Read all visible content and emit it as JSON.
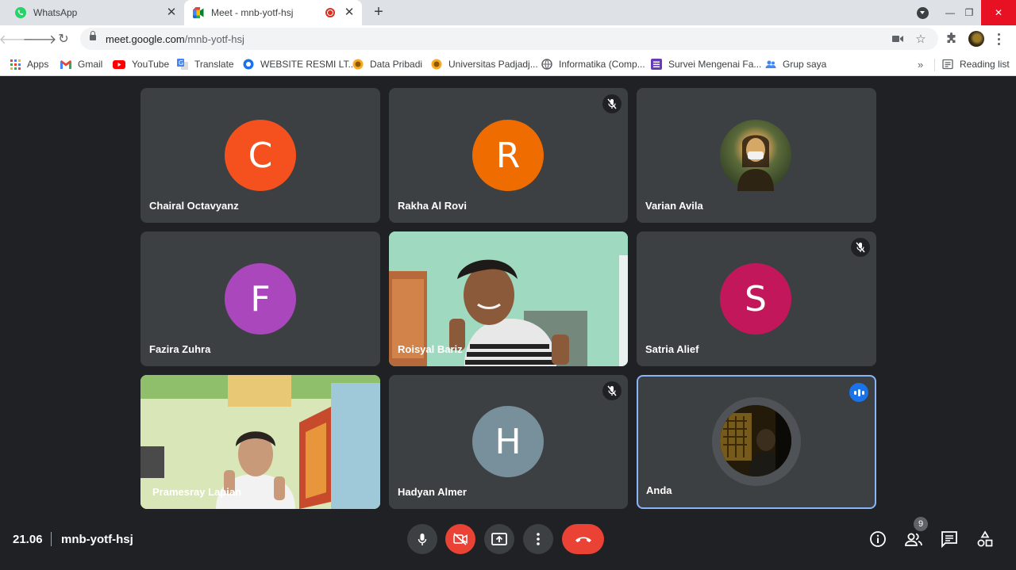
{
  "browser": {
    "tabs": [
      {
        "title": "WhatsApp",
        "active": false
      },
      {
        "title": "Meet - mnb-yotf-hsj",
        "active": true,
        "recording": true
      }
    ],
    "address": {
      "host": "meet.google.com",
      "path": "/mnb-yotf-hsj"
    },
    "bookmarks": [
      {
        "label": "Apps",
        "icon": "apps-grid-icon"
      },
      {
        "label": "Gmail",
        "icon": "gmail-icon"
      },
      {
        "label": "YouTube",
        "icon": "youtube-icon"
      },
      {
        "label": "Translate",
        "icon": "translate-icon"
      },
      {
        "label": "WEBSITE RESMI LT...",
        "icon": "globe-icon"
      },
      {
        "label": "Data Pribadi",
        "icon": "unpad-icon"
      },
      {
        "label": "Universitas Padjadj...",
        "icon": "unpad-icon"
      },
      {
        "label": "Informatika (Comp...",
        "icon": "globe-icon"
      },
      {
        "label": "Survei Mengenai Fa...",
        "icon": "forms-icon"
      },
      {
        "label": "Grup saya",
        "icon": "groups-icon"
      }
    ],
    "reading_list": "Reading list",
    "more_bookmarks": "»"
  },
  "meet": {
    "participants": [
      {
        "name": "Chairal Octavyanz",
        "initial": "C",
        "color": "#f4511e",
        "type": "letter",
        "muted": false
      },
      {
        "name": "Rakha Al Rovi",
        "initial": "R",
        "color": "#ef6c00",
        "type": "letter",
        "muted": true
      },
      {
        "name": "Varian Avila",
        "type": "photo-avatar",
        "muted": false
      },
      {
        "name": "Fazira Zuhra",
        "initial": "F",
        "color": "#ab47bc",
        "type": "letter",
        "muted": false
      },
      {
        "name": "Roisyal Bariz",
        "type": "video",
        "muted": false
      },
      {
        "name": "Satria Alief",
        "initial": "S",
        "color": "#c2185b",
        "type": "letter",
        "muted": true
      },
      {
        "name": "Pramesray Lapian",
        "type": "video",
        "muted": false
      },
      {
        "name": "Hadyan Almer",
        "initial": "H",
        "color": "#78909c",
        "type": "letter",
        "muted": true
      },
      {
        "name": "Anda",
        "type": "photo-avatar",
        "muted": false,
        "speaking": true
      }
    ],
    "time": "21.06",
    "meeting_code": "mnb-yotf-hsj",
    "participant_count": "9",
    "colors": {
      "accent": "#8ab4f8",
      "end_call": "#ea4335",
      "tile": "#3c4043",
      "background": "#202124"
    }
  }
}
